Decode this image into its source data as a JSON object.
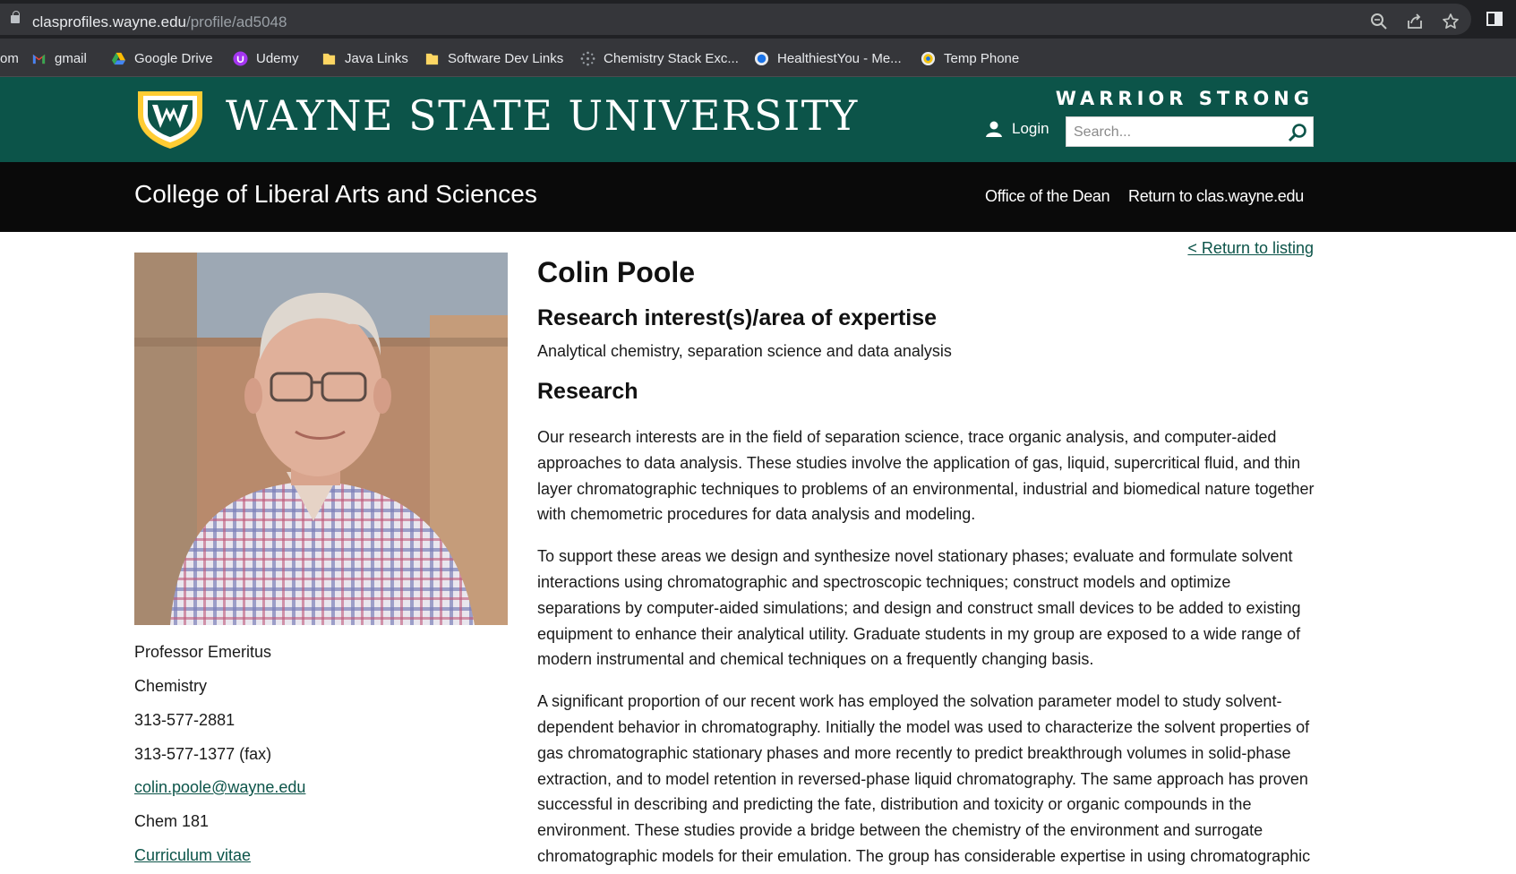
{
  "browser": {
    "url_host": "clasprofiles.wayne.edu",
    "url_path": "/profile/ad5048",
    "icons": [
      "zoom-icon",
      "share-icon",
      "bookmark-star-icon",
      "sidebar-icon"
    ],
    "bookmarks": [
      {
        "label": "om",
        "icon": "none"
      },
      {
        "label": "gmail",
        "icon": "gmail-icon"
      },
      {
        "label": "Google Drive",
        "icon": "google-drive-icon"
      },
      {
        "label": "Udemy",
        "icon": "udemy-icon"
      },
      {
        "label": "Java Links",
        "icon": "folder-icon"
      },
      {
        "label": "Software Dev Links",
        "icon": "folder-icon"
      },
      {
        "label": "Chemistry Stack Exc...",
        "icon": "stack-exchange-icon"
      },
      {
        "label": "HealthiestYou - Me...",
        "icon": "healthiestyou-icon"
      },
      {
        "label": "Temp Phone",
        "icon": "temp-phone-icon"
      }
    ]
  },
  "header": {
    "university": "WAYNE STATE UNIVERSITY",
    "tagline": "WARRIOR STRONG",
    "login_label": "Login",
    "search_placeholder": "Search...",
    "brand_green": "#0c5449",
    "brand_gold": "#ffcc33"
  },
  "college_bar": {
    "name": "College of Liberal Arts and Sciences",
    "links": [
      "Office of the Dean",
      "Return to clas.wayne.edu"
    ]
  },
  "profile": {
    "return_link": "< Return to listing",
    "name": "Colin Poole",
    "interest_heading": "Research interest(s)/area of expertise",
    "interest_text": "Analytical chemistry, separation science and data analysis",
    "research_heading": "Research",
    "paragraphs": [
      "Our research interests are in the field of separation science, trace organic analysis, and computer-aided approaches to data analysis. These studies involve the application of gas, liquid, supercritical fluid, and thin layer chromatographic techniques to problems of an environmental, industrial and biomedical nature together with chemometric procedures for data analysis and modeling.",
      "To support these areas we design and synthesize novel stationary phases; evaluate and formulate solvent interactions using chromatographic and spectroscopic techniques; construct models and optimize separations by computer-aided simulations; and design and construct small devices to be added to existing equipment to enhance their analytical utility. Graduate students in my group are exposed to a wide range of modern instrumental and chemical techniques on a frequently changing basis.",
      "A significant proportion of our recent work has employed the solvation parameter model to study solvent-dependent behavior in chromatography. Initially the model was used to characterize the solvent properties of gas chromatographic stationary phases and more recently to predict breakthrough volumes in solid-phase extraction, and to model retention in reversed-phase liquid chromatography. The same approach has proven successful in describing and predicting the fate, distribution and toxicity or organic compounds in the environment. These studies provide a bridge between the chemistry of the environment and surrogate chromatographic models for their emulation. The group has considerable expertise in using chromatographic"
    ],
    "sidebar": {
      "title": "Professor Emeritus",
      "department": "Chemistry",
      "phone": "313-577-2881",
      "fax": "313-577-1377 (fax)",
      "email": "colin.poole@wayne.edu",
      "office": "Chem 181",
      "cv_link": "Curriculum vitae"
    }
  }
}
